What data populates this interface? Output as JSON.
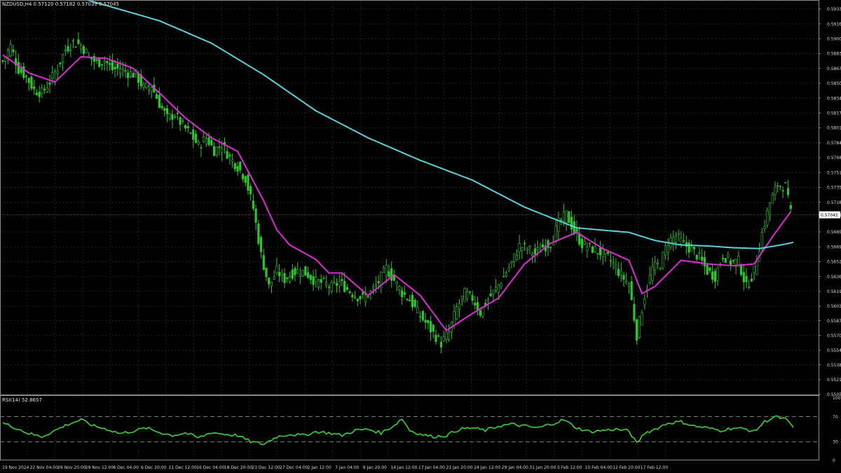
{
  "header": {
    "symbol_label": "NZDUSD,H4  0.57120 0.57182 0.57039 0.57045"
  },
  "rsi_header": {
    "label": "RSI(14) 52.8657"
  },
  "colors": {
    "background": "#000000",
    "grid": "#3a3a3a",
    "candle": "#2fc52f",
    "price_line": "#ffffff",
    "ma_fast": "#e02ad6",
    "ma_slow": "#58d2dc",
    "rsi_line": "#3ad23a"
  },
  "chart_data": [
    {
      "type": "candlestick",
      "title": "NZDUSD,H4",
      "last_price": "0.57045",
      "ylim": [
        0.5505,
        0.5943
      ],
      "y_ticks": [
        "0.59330",
        "0.59165",
        "0.59000",
        "0.58835",
        "0.58670",
        "0.58505",
        "0.58340",
        "0.58175",
        "0.58010",
        "0.57845",
        "0.57680",
        "0.57515",
        "0.57350",
        "0.57185",
        "0.57045",
        "0.56855",
        "0.56690",
        "0.56525",
        "0.56360",
        "0.56195",
        "0.56030",
        "0.55870",
        "0.55705",
        "0.55540",
        "0.55380",
        "0.55215",
        "0.55050"
      ],
      "x_ticks": [
        "19 Nov 2024",
        "22 Nov 04:00",
        "26 Nov 20:00",
        "29 Nov 12:00",
        "4 Dec 04:00",
        "6 Dec 20:00",
        "11 Dec 12:00",
        "16 Dec 04:00",
        "18 Dec 20:00",
        "23 Dec 12:00",
        "27 Dec 04:00",
        "2 Jan 12:00",
        "7 Jan 04:00",
        "9 Jan 20:00",
        "14 Jan 12:00",
        "17 Jan 04:00",
        "21 Jan 20:00",
        "24 Jan 12:00",
        "29 Jan 04:00",
        "31 Jan 20:00",
        "5 Feb 12:00",
        "10 Feb 04:00",
        "12 Feb 20:00",
        "17 Feb 12:00"
      ],
      "close_path": [
        [
          0,
          0.5875
        ],
        [
          3,
          0.5892
        ],
        [
          6,
          0.5866
        ],
        [
          9,
          0.5858
        ],
        [
          12,
          0.5843
        ],
        [
          15,
          0.584
        ],
        [
          18,
          0.5852
        ],
        [
          21,
          0.5868
        ],
        [
          24,
          0.5888
        ],
        [
          27,
          0.5896
        ],
        [
          30,
          0.5893
        ],
        [
          33,
          0.588
        ],
        [
          36,
          0.5873
        ],
        [
          39,
          0.5876
        ],
        [
          42,
          0.5866
        ],
        [
          45,
          0.5867
        ],
        [
          48,
          0.5862
        ],
        [
          51,
          0.586
        ],
        [
          54,
          0.5845
        ],
        [
          57,
          0.5848
        ],
        [
          60,
          0.5828
        ],
        [
          63,
          0.5812
        ],
        [
          66,
          0.5816
        ],
        [
          69,
          0.5803
        ],
        [
          72,
          0.5794
        ],
        [
          75,
          0.5781
        ],
        [
          78,
          0.579
        ],
        [
          81,
          0.5776
        ],
        [
          84,
          0.5782
        ],
        [
          87,
          0.5768
        ],
        [
          90,
          0.5758
        ],
        [
          93,
          0.5745
        ],
        [
          96,
          0.5712
        ],
        [
          99,
          0.566
        ],
        [
          102,
          0.5625
        ],
        [
          105,
          0.5642
        ],
        [
          108,
          0.5633
        ],
        [
          111,
          0.564
        ],
        [
          114,
          0.5643
        ],
        [
          117,
          0.5638
        ],
        [
          120,
          0.563
        ],
        [
          123,
          0.5629
        ],
        [
          126,
          0.5624
        ],
        [
          129,
          0.563
        ],
        [
          132,
          0.5622
        ],
        [
          135,
          0.5615
        ],
        [
          138,
          0.5612
        ],
        [
          141,
          0.5618
        ],
        [
          144,
          0.563
        ],
        [
          147,
          0.5645
        ],
        [
          150,
          0.5632
        ],
        [
          153,
          0.5618
        ],
        [
          156,
          0.561
        ],
        [
          159,
          0.5596
        ],
        [
          162,
          0.5585
        ],
        [
          165,
          0.5573
        ],
        [
          168,
          0.5562
        ],
        [
          171,
          0.5574
        ],
        [
          174,
          0.5601
        ],
        [
          177,
          0.5617
        ],
        [
          180,
          0.5612
        ],
        [
          183,
          0.5596
        ],
        [
          186,
          0.5611
        ],
        [
          189,
          0.5622
        ],
        [
          192,
          0.5636
        ],
        [
          195,
          0.5651
        ],
        [
          198,
          0.567
        ],
        [
          201,
          0.5667
        ],
        [
          204,
          0.5661
        ],
        [
          207,
          0.5669
        ],
        [
          210,
          0.5673
        ],
        [
          213,
          0.5695
        ],
        [
          216,
          0.5705
        ],
        [
          219,
          0.5686
        ],
        [
          222,
          0.5672
        ],
        [
          225,
          0.5668
        ],
        [
          228,
          0.5664
        ],
        [
          231,
          0.566
        ],
        [
          234,
          0.565
        ],
        [
          237,
          0.5637
        ],
        [
          240,
          0.5628
        ],
        [
          243,
          0.5571
        ],
        [
          246,
          0.5615
        ],
        [
          249,
          0.5645
        ],
        [
          252,
          0.565
        ],
        [
          255,
          0.5675
        ],
        [
          258,
          0.5681
        ],
        [
          261,
          0.5672
        ],
        [
          264,
          0.5666
        ],
        [
          267,
          0.5657
        ],
        [
          270,
          0.5642
        ],
        [
          273,
          0.5636
        ],
        [
          276,
          0.566
        ],
        [
          279,
          0.5652
        ],
        [
          282,
          0.5653
        ],
        [
          285,
          0.5624
        ],
        [
          288,
          0.5642
        ],
        [
          291,
          0.5684
        ],
        [
          294,
          0.5718
        ],
        [
          297,
          0.5738
        ],
        [
          300,
          0.5736
        ],
        [
          302,
          0.5706
        ]
      ],
      "series": [
        {
          "style": "magenta",
          "values": [
            [
              0,
              0.5882
            ],
            [
              10,
              0.5862
            ],
            [
              20,
              0.5852
            ],
            [
              30,
              0.588
            ],
            [
              40,
              0.5878
            ],
            [
              50,
              0.5867
            ],
            [
              60,
              0.584
            ],
            [
              70,
              0.5812
            ],
            [
              80,
              0.579
            ],
            [
              90,
              0.5775
            ],
            [
              100,
              0.572
            ],
            [
              105,
              0.5688
            ],
            [
              110,
              0.5671
            ],
            [
              120,
              0.5655
            ],
            [
              125,
              0.564
            ],
            [
              130,
              0.564
            ],
            [
              140,
              0.5615
            ],
            [
              150,
              0.5638
            ],
            [
              160,
              0.5615
            ],
            [
              170,
              0.5576
            ],
            [
              180,
              0.5595
            ],
            [
              190,
              0.5612
            ],
            [
              200,
              0.565
            ],
            [
              210,
              0.5673
            ],
            [
              220,
              0.5685
            ],
            [
              230,
              0.5667
            ],
            [
              240,
              0.5654
            ],
            [
              245,
              0.5617
            ],
            [
              250,
              0.5625
            ],
            [
              260,
              0.5654
            ],
            [
              270,
              0.565
            ],
            [
              280,
              0.5648
            ],
            [
              288,
              0.565
            ],
            [
              295,
              0.568
            ],
            [
              302,
              0.5708
            ]
          ]
        },
        {
          "style": "cyan",
          "values": [
            [
              0,
              0.5975
            ],
            [
              30,
              0.5945
            ],
            [
              60,
              0.592
            ],
            [
              80,
              0.5895
            ],
            [
              100,
              0.586
            ],
            [
              120,
              0.582
            ],
            [
              140,
              0.579
            ],
            [
              160,
              0.5765
            ],
            [
              180,
              0.5743
            ],
            [
              200,
              0.5713
            ],
            [
              220,
              0.569
            ],
            [
              240,
              0.5685
            ],
            [
              250,
              0.5676
            ],
            [
              260,
              0.5671
            ],
            [
              270,
              0.567
            ],
            [
              280,
              0.5668
            ],
            [
              290,
              0.5667
            ],
            [
              300,
              0.5672
            ],
            [
              303,
              0.5674
            ]
          ]
        }
      ]
    },
    {
      "type": "line",
      "title": "RSI(14)",
      "ylim": [
        0,
        100
      ],
      "y_ticks": [
        "100",
        "70",
        "30",
        "0"
      ],
      "levels": [
        70,
        30
      ],
      "series": [
        {
          "style": "green",
          "values": [
            [
              0,
              60
            ],
            [
              5,
              52
            ],
            [
              10,
              43
            ],
            [
              15,
              38
            ],
            [
              20,
              48
            ],
            [
              25,
              58
            ],
            [
              30,
              65
            ],
            [
              35,
              55
            ],
            [
              40,
              50
            ],
            [
              45,
              43
            ],
            [
              50,
              47
            ],
            [
              55,
              52
            ],
            [
              60,
              45
            ],
            [
              65,
              40
            ],
            [
              70,
              44
            ],
            [
              75,
              36
            ],
            [
              80,
              45
            ],
            [
              85,
              42
            ],
            [
              90,
              40
            ],
            [
              95,
              30
            ],
            [
              100,
              26
            ],
            [
              105,
              38
            ],
            [
              110,
              42
            ],
            [
              115,
              40
            ],
            [
              120,
              46
            ],
            [
              125,
              44
            ],
            [
              130,
              40
            ],
            [
              135,
              48
            ],
            [
              140,
              50
            ],
            [
              145,
              44
            ],
            [
              150,
              56
            ],
            [
              153,
              67
            ],
            [
              156,
              48
            ],
            [
              160,
              42
            ],
            [
              165,
              38
            ],
            [
              170,
              40
            ],
            [
              175,
              50
            ],
            [
              180,
              52
            ],
            [
              185,
              48
            ],
            [
              190,
              55
            ],
            [
              195,
              58
            ],
            [
              200,
              55
            ],
            [
              205,
              52
            ],
            [
              210,
              58
            ],
            [
              215,
              65
            ],
            [
              220,
              52
            ],
            [
              225,
              46
            ],
            [
              230,
              48
            ],
            [
              235,
              50
            ],
            [
              240,
              47
            ],
            [
              243,
              27
            ],
            [
              246,
              44
            ],
            [
              250,
              50
            ],
            [
              255,
              60
            ],
            [
              260,
              62
            ],
            [
              265,
              55
            ],
            [
              270,
              52
            ],
            [
              275,
              48
            ],
            [
              280,
              52
            ],
            [
              285,
              50
            ],
            [
              288,
              46
            ],
            [
              292,
              62
            ],
            [
              296,
              70
            ],
            [
              300,
              66
            ],
            [
              303,
              53
            ]
          ]
        }
      ]
    }
  ]
}
